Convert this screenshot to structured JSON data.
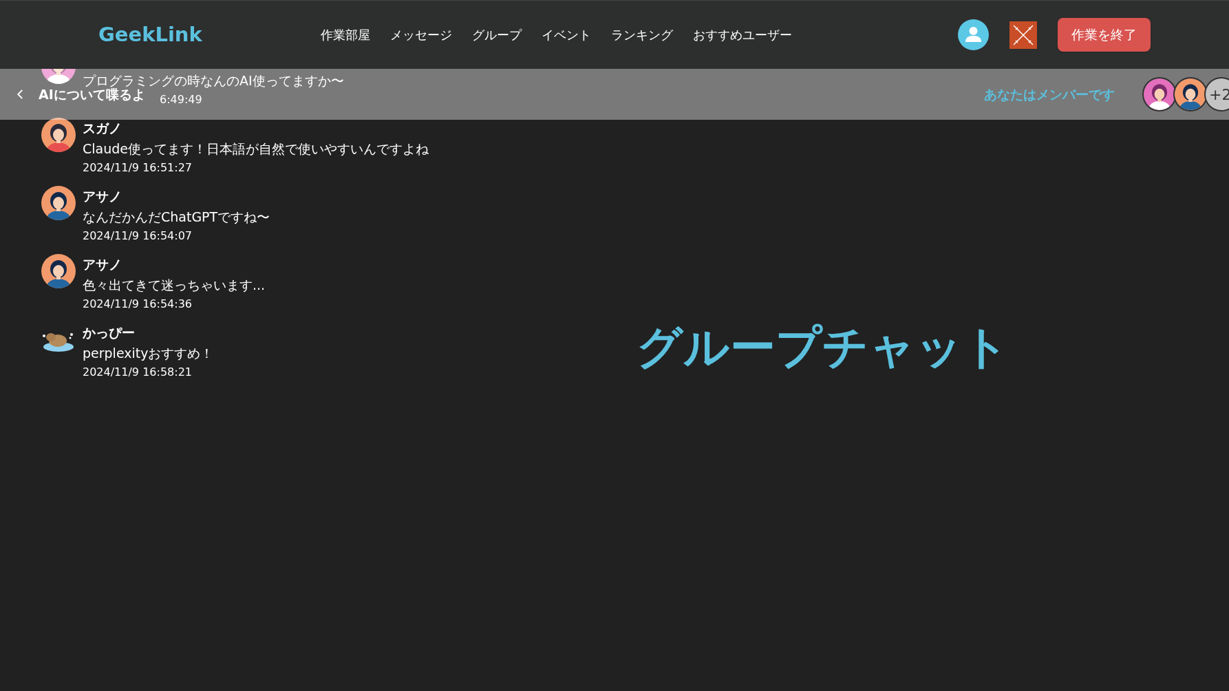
{
  "nav": {
    "logo": "GeekLink",
    "links": [
      "作業部屋",
      "メッセージ",
      "グループ",
      "イベント",
      "ランキング",
      "おすすめユーザー"
    ],
    "end_button": "作業を終了"
  },
  "group_bar": {
    "title": "AIについて喋るよ",
    "membership": "あなたはメンバーです",
    "member_avatars": [
      {
        "kind": "woman-pink"
      },
      {
        "kind": "woman-blue"
      }
    ],
    "more_count": "+2"
  },
  "messages": [
    {
      "avatar": {
        "kind": "woman-pink"
      },
      "text": "プログラミングの時なんのAI使ってますか〜",
      "time": "6:49:49"
    },
    {
      "avatar": {
        "kind": "woman-red"
      },
      "name": "スガノ",
      "text": "Claude使ってます！日本語が自然で使いやすいんですよね",
      "time": "2024/11/9 16:51:27"
    },
    {
      "avatar": {
        "kind": "woman-blue"
      },
      "name": "アサノ",
      "text": "なんだかんだChatGPTですね〜",
      "time": "2024/11/9 16:54:07"
    },
    {
      "avatar": {
        "kind": "woman-blue"
      },
      "name": "アサノ",
      "text": "色々出てきて迷っちゃいます...",
      "time": "2024/11/9 16:54:36"
    },
    {
      "avatar": {
        "kind": "capybara"
      },
      "name": "かっぴー",
      "text": "perplexityおすすめ！",
      "time": "2024/11/9 16:58:21"
    }
  ],
  "heading": "グループチャット"
}
